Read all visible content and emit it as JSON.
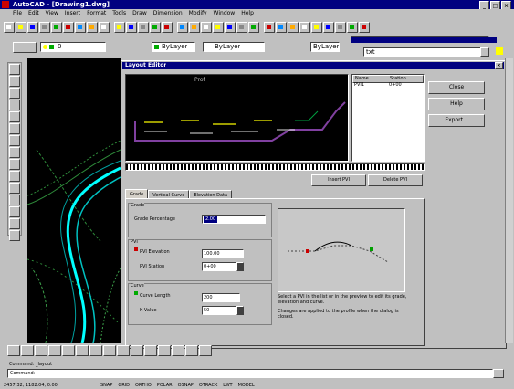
{
  "app": {
    "title": "AutoCAD - [Drawing1.dwg]",
    "menu": [
      "File",
      "Edit",
      "View",
      "Insert",
      "Format",
      "Tools",
      "Draw",
      "Dimension",
      "Modify",
      "Window",
      "Help"
    ]
  },
  "toolbars": {
    "layer_value": "0",
    "layer_control_value": "ByLayer",
    "linetype_value": "ByLayer",
    "lineweight_value": "ByLayer",
    "font_value": "txt"
  },
  "dialog": {
    "title": "Layout Editor",
    "preview_caption": "Prof",
    "list_headers": [
      "Name",
      "Station"
    ],
    "list_rows": [
      [
        "PVI1",
        "0+00"
      ]
    ],
    "buttons": [
      "Close",
      "Help",
      "Export..."
    ],
    "mid_buttons": [
      "Insert PVI",
      "Delete PVI"
    ],
    "tabs": [
      "Grade",
      "Vertical Curve",
      "Elevation Data"
    ],
    "groups": [
      {
        "title": "Grade",
        "fields": [
          {
            "label": "Grade Percentage",
            "value": "2.00"
          }
        ]
      },
      {
        "title": "PVI",
        "fields": [
          {
            "label": "PVI Elevation",
            "value": "100.00"
          },
          {
            "label": "PVI Station",
            "value": "0+00"
          }
        ]
      },
      {
        "title": "Curve",
        "fields": [
          {
            "label": "Curve Length",
            "value": "200"
          },
          {
            "label": "K Value",
            "value": "50"
          }
        ]
      }
    ],
    "notes": [
      "Select a PVI in the list or in the preview to edit its grade, elevation and curve.",
      "Changes are applied to the profile when the dialog is closed."
    ]
  },
  "command": {
    "history": "Command: _layout",
    "prompt": "Command:"
  },
  "status": {
    "coords": "2457.32, 1182.04, 0.00",
    "modes": [
      "SNAP",
      "GRID",
      "ORTHO",
      "POLAR",
      "OSNAP",
      "OTRACK",
      "LWT",
      "MODEL"
    ]
  },
  "colors": {
    "title_bar": "#000080",
    "canvas": "#000000",
    "road_cyan": "#00ffff",
    "contour_green": "#2e8b3a",
    "profile_purple": "#8040a0",
    "profile_yellow": "#d0d000"
  }
}
